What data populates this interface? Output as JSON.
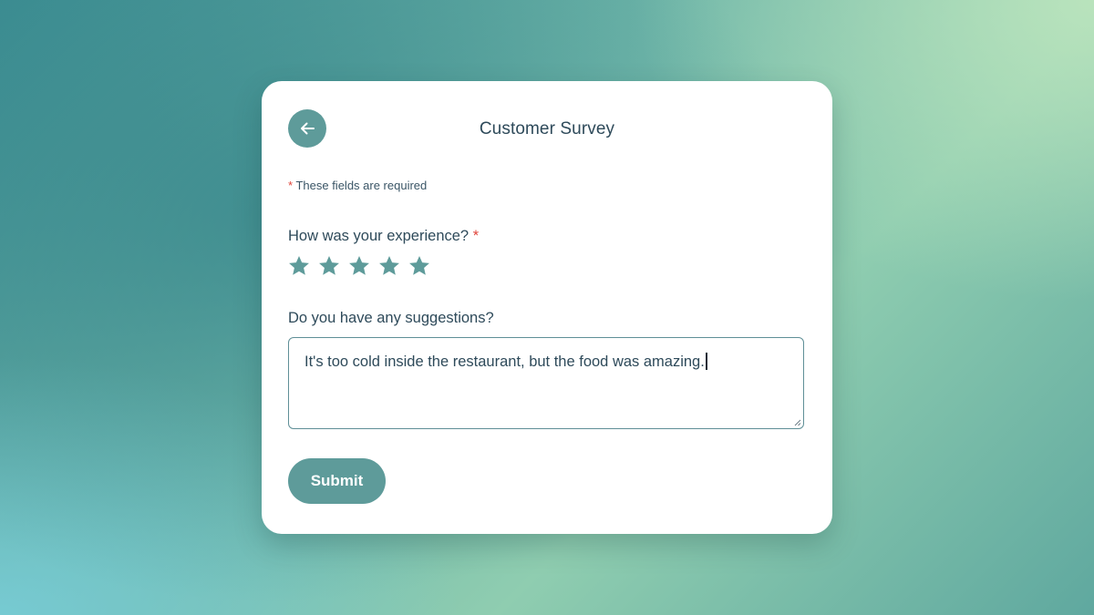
{
  "survey": {
    "title": "Customer Survey",
    "back_button_icon": "arrow-left-icon",
    "required_note": {
      "asterisk": "*",
      "text": "These fields are required"
    },
    "rating_question": {
      "label": "How was your experience?",
      "required_marker": "*",
      "star_icon": "star-icon",
      "star_count": 5,
      "selected_rating": 5
    },
    "suggestion_question": {
      "label": "Do you have any suggestions?",
      "value": "It's too cold inside the restaurant, but the food was amazing."
    },
    "submit_label": "Submit"
  },
  "colors": {
    "accent": "#5e9b9a",
    "text": "#2e4a5a",
    "required": "#e0463c",
    "card": "#ffffff"
  }
}
